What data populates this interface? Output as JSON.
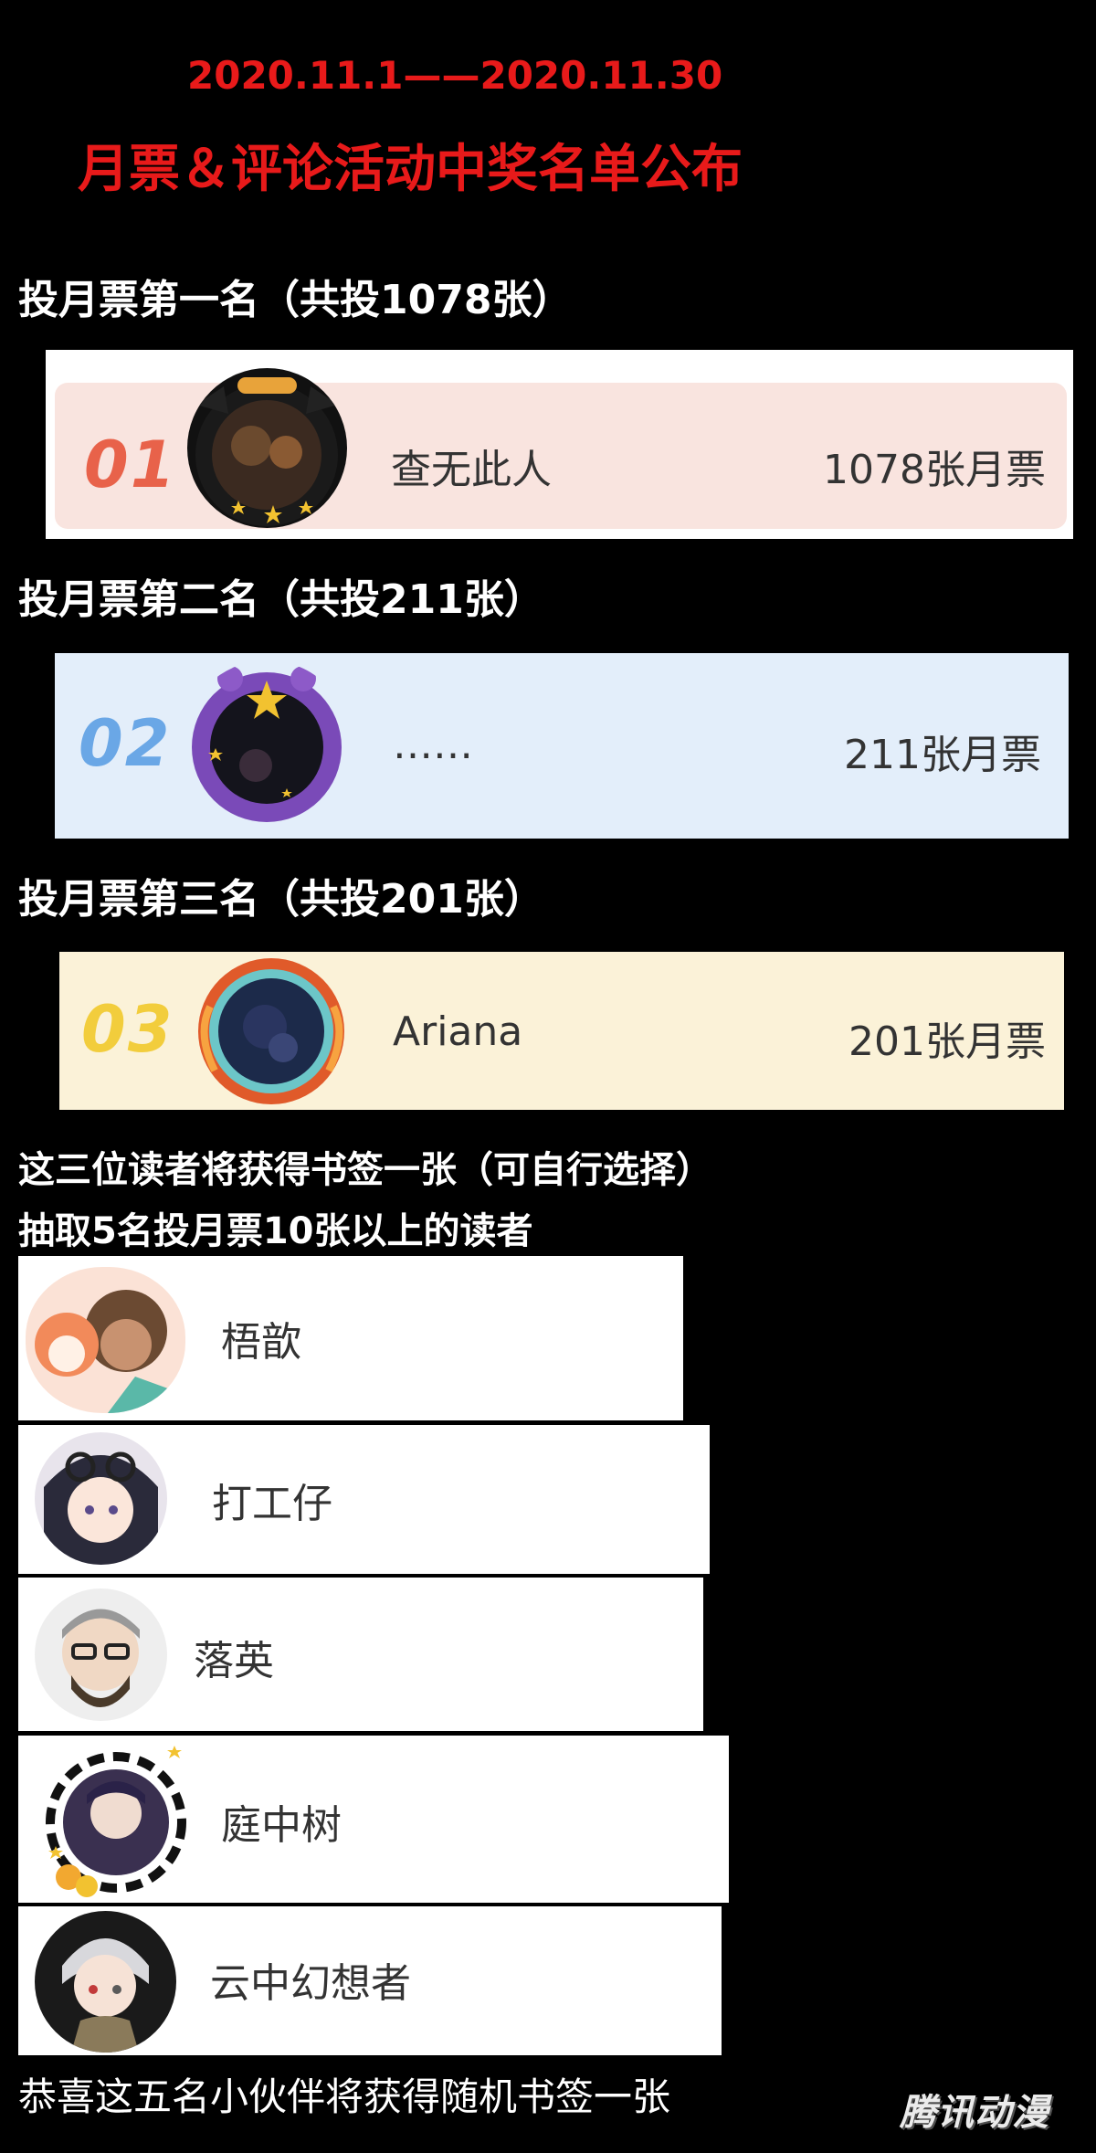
{
  "header": {
    "date_range": "2020.11.1——2020.11.30",
    "title": "月票＆评论活动中奖名单公布"
  },
  "rankings": [
    {
      "heading": "投月票第一名（共投1078张）",
      "rank": "01",
      "name": "查无此人",
      "votes": "1078张月票",
      "rank_color": "#e8624a",
      "card_bg": "#f9e4df"
    },
    {
      "heading": "投月票第二名（共投211张）",
      "rank": "02",
      "name": "……",
      "votes": "211张月票",
      "rank_color": "#6aa7e6",
      "card_bg": "#e3eefa"
    },
    {
      "heading": "投月票第三名（共投201张）",
      "rank": "03",
      "name": "Ariana",
      "votes": "201张月票",
      "rank_color": "#f2cd3c",
      "card_bg": "#fbf2d8"
    }
  ],
  "top3_note": "这三位读者将获得书签一张（可自行选择）",
  "lottery_heading": "抽取5名投月票10张以上的读者",
  "winners": [
    {
      "name": "梧歆"
    },
    {
      "name": "打工仔"
    },
    {
      "name": "落英"
    },
    {
      "name": "庭中树"
    },
    {
      "name": "云中幻想者"
    }
  ],
  "footer_note": "恭喜这五名小伙伴将获得随机书签一张",
  "watermark": "腾讯动漫"
}
